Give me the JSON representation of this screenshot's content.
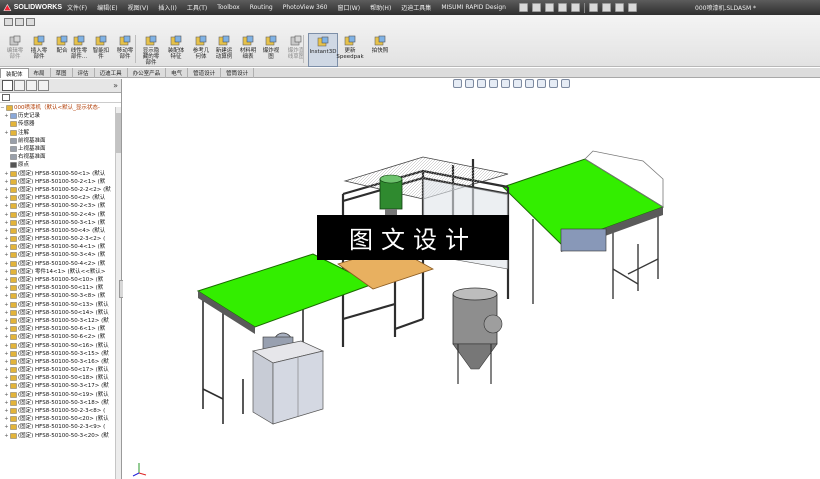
{
  "app": {
    "logo_text": "SOLIDWORKS",
    "document_title": "000喷漆机.SLDASM *"
  },
  "menu": [
    "文件(F)",
    "编辑(E)",
    "视图(V)",
    "插入(I)",
    "工具(T)",
    "Toolbox",
    "Routing",
    "PhotoView 360",
    "窗口(W)",
    "帮助(H)",
    "迈迪工具集",
    "MISUMI RAPID Design"
  ],
  "commands": [
    {
      "label": "编辑零\n部件",
      "icon": "edit-component-icon",
      "dim": true
    },
    {
      "label": "插入零\n部件",
      "icon": "insert-component-icon",
      "dim": false
    },
    {
      "label": "配合",
      "icon": "mate-icon",
      "dim": false
    },
    {
      "label": "线性零\n部件...",
      "icon": "linear-pattern-icon",
      "dim": false
    },
    {
      "label": "智能扣\n件",
      "icon": "smart-fastener-icon",
      "dim": false
    },
    {
      "label": "移动零\n部件",
      "icon": "move-component-icon",
      "dim": false
    },
    {
      "label": "显示隐\n藏的零\n部件",
      "icon": "show-hidden-icon",
      "dim": false
    },
    {
      "label": "装配体\n特征",
      "icon": "assembly-feature-icon",
      "dim": false
    },
    {
      "label": "参考几\n何体",
      "icon": "reference-geometry-icon",
      "dim": false
    },
    {
      "label": "新建运\n动算例",
      "icon": "motion-study-icon",
      "dim": false
    },
    {
      "label": "材料明\n细表",
      "icon": "bom-icon",
      "dim": false
    },
    {
      "label": "爆炸视\n图",
      "icon": "exploded-view-icon",
      "dim": false
    },
    {
      "label": "爆炸直\n线草图",
      "icon": "explode-line-icon",
      "dim": true
    },
    {
      "label": "Instant3D",
      "icon": "instant3d-icon",
      "dim": false,
      "pressed": true
    },
    {
      "label": "更新\nSpeedpak",
      "icon": "speedpak-icon",
      "dim": false
    },
    {
      "label": "拍快照",
      "icon": "snapshot-icon",
      "dim": false
    }
  ],
  "tabs": [
    "装配体",
    "布局",
    "草图",
    "评估",
    "迈迪工具",
    "办公室产品",
    "电气",
    "管道设计",
    "管筒设计"
  ],
  "tree": {
    "root": "000喷漆机（默认<默认_显示状态-",
    "items": [
      {
        "text": "历史记录",
        "icon": "history-icon",
        "toggle": "+"
      },
      {
        "text": "传感器",
        "icon": "sensor-icon",
        "toggle": ""
      },
      {
        "text": "注解",
        "icon": "annotation-icon",
        "toggle": "+"
      },
      {
        "text": "前视基准面",
        "icon": "plane-icon",
        "toggle": ""
      },
      {
        "text": "上视基准面",
        "icon": "plane-icon",
        "toggle": ""
      },
      {
        "text": "右视基准面",
        "icon": "plane-icon",
        "toggle": ""
      },
      {
        "text": "原点",
        "icon": "origin-icon",
        "toggle": ""
      },
      {
        "text": "(固定) HFS8-50100-50<1> (默认",
        "icon": "part-icon",
        "toggle": "+"
      },
      {
        "text": "(固定) HFS8-50100-50-2<1> (默",
        "icon": "part-icon",
        "toggle": "+"
      },
      {
        "text": "(固定) HFS8-50100-50-2-2<2> (默",
        "icon": "part-icon",
        "toggle": "+"
      },
      {
        "text": "(固定) HFS8-50100-50<2> (默认",
        "icon": "part-icon",
        "toggle": "+"
      },
      {
        "text": "(固定) HFS8-50100-50-2<3> (默",
        "icon": "part-icon",
        "toggle": "+"
      },
      {
        "text": "(固定) HFS8-50100-50-2<4> (默",
        "icon": "part-icon",
        "toggle": "+"
      },
      {
        "text": "(固定) HFS8-50100-50-3<1> (默",
        "icon": "part-icon",
        "toggle": "+"
      },
      {
        "text": "(固定) HFS8-50100-50<4> (默认",
        "icon": "part-icon",
        "toggle": "+"
      },
      {
        "text": "(固定) HFS8-50100-50-2-3<2> (",
        "icon": "part-icon",
        "toggle": "+"
      },
      {
        "text": "(固定) HFS8-50100-50-4<1> (默",
        "icon": "part-icon",
        "toggle": "+"
      },
      {
        "text": "(固定) HFS8-50100-50-3<4> (默",
        "icon": "part-icon",
        "toggle": "+"
      },
      {
        "text": "(固定) HFS8-50100-50-4<2> (默",
        "icon": "part-icon",
        "toggle": "+"
      },
      {
        "text": "(固定) 零件14<1> (默认<<默认>",
        "icon": "part-icon",
        "toggle": "+"
      },
      {
        "text": "(固定) HFS8-50100-50<10> (默",
        "icon": "part-icon",
        "toggle": "+"
      },
      {
        "text": "(固定) HFS8-50100-50<11> (默",
        "icon": "part-icon",
        "toggle": "+"
      },
      {
        "text": "(固定) HFS8-50100-50-3<8> (默",
        "icon": "part-icon",
        "toggle": "+"
      },
      {
        "text": "(固定) HFS8-50100-50<13> (默认",
        "icon": "part-icon",
        "toggle": "+"
      },
      {
        "text": "(固定) HFS8-50100-50<14> (默认",
        "icon": "part-icon",
        "toggle": "+"
      },
      {
        "text": "(固定) HFS8-50100-50-3<12> (默",
        "icon": "part-icon",
        "toggle": "+"
      },
      {
        "text": "(固定) HFS8-50100-50-6<1> (默",
        "icon": "part-icon",
        "toggle": "+"
      },
      {
        "text": "(固定) HFS8-50100-50-6<2> (默",
        "icon": "part-icon",
        "toggle": "+"
      },
      {
        "text": "(固定) HFS8-50100-50<16> (默认",
        "icon": "part-icon",
        "toggle": "+"
      },
      {
        "text": "(固定) HFS8-50100-50-3<15> (默",
        "icon": "part-icon",
        "toggle": "+"
      },
      {
        "text": "(固定) HFS8-50100-50-3<16> (默",
        "icon": "part-icon",
        "toggle": "+"
      },
      {
        "text": "(固定) HFS8-50100-50<17> (默认",
        "icon": "part-icon",
        "toggle": "+"
      },
      {
        "text": "(固定) HFS8-50100-50<18> (默认",
        "icon": "part-icon",
        "toggle": "+"
      },
      {
        "text": "(固定) HFS8-50100-50-3<17> (默",
        "icon": "part-icon",
        "toggle": "+"
      },
      {
        "text": "(固定) HFS8-50100-50<19> (默认",
        "icon": "part-icon",
        "toggle": "+"
      },
      {
        "text": "(固定) HFS8-50100-50-3<18> (默",
        "icon": "part-icon",
        "toggle": "+"
      },
      {
        "text": "(固定) HFS8-50100-50-2-3<8> (",
        "icon": "part-icon",
        "toggle": "+"
      },
      {
        "text": "(固定) HFS8-50100-50<20> (默认",
        "icon": "part-icon",
        "toggle": "+"
      },
      {
        "text": "(固定) HFS8-50100-50-2-3<9> (",
        "icon": "part-icon",
        "toggle": "+"
      },
      {
        "text": "(固定) HFS8-50100-50-3<20> (默",
        "icon": "part-icon",
        "toggle": "+"
      }
    ]
  },
  "overlay_text": "图文设计",
  "colors": {
    "conveyor_green": "#33ee00",
    "frame": "#4a4a4a",
    "wood": "#e8b060",
    "tree_root": "#b03a00"
  }
}
